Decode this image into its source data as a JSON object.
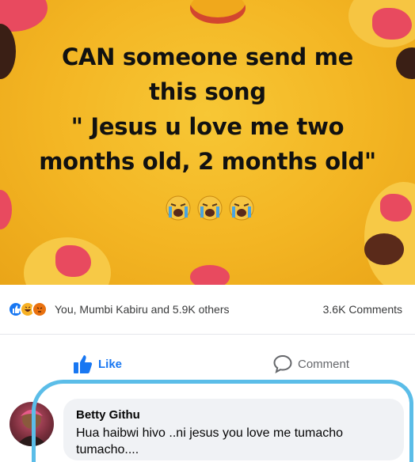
{
  "post": {
    "lines": [
      "CAN someone send me",
      "this song",
      "\" Jesus u love me two",
      "months old, 2 months old\""
    ]
  },
  "reactions": {
    "names": "You, Mumbi Kabiru and 5.9K others",
    "comments": "3.6K Comments"
  },
  "actions": {
    "like_label": "Like",
    "comment_label": "Comment"
  },
  "comment": {
    "author": "Betty Githu",
    "text": "Hua haibwi hivo ..ni jesus you love me tumacho tumacho...."
  },
  "colors": {
    "background_yellow": "#f3b523",
    "facebook_blue": "#1877f2",
    "highlight_stroke": "#5bbde8"
  },
  "icons": [
    "like-reaction-icon",
    "haha-reaction-icon",
    "angry-reaction-icon",
    "thumbs-up-icon",
    "comment-icon",
    "crying-face-icon"
  ]
}
